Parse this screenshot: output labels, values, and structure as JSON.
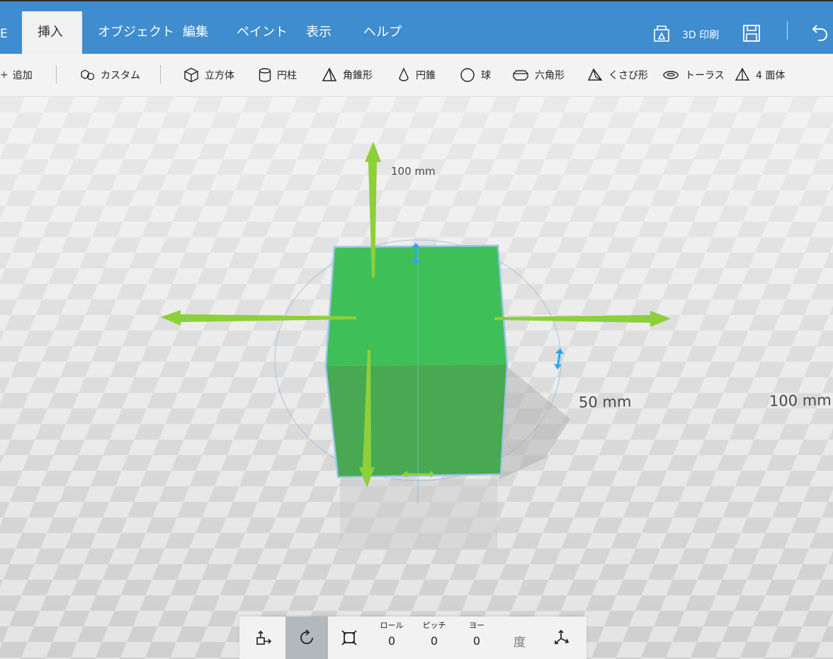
{
  "menubar": {
    "edge_label": "E",
    "tabs": [
      {
        "label": "挿入",
        "active": true
      },
      {
        "label": "オブジェクト",
        "active": false
      },
      {
        "label": "編集",
        "active": false
      },
      {
        "label": "ペイント",
        "active": false
      },
      {
        "label": "表示",
        "active": false
      },
      {
        "label": "ヘルプ",
        "active": false
      }
    ],
    "print_label": "3D 印刷"
  },
  "ribbon": {
    "add_label": "追加",
    "custom_label": "カスタム",
    "shapes": [
      {
        "label": "立方体",
        "icon": "cube-icon"
      },
      {
        "label": "円柱",
        "icon": "cylinder-icon"
      },
      {
        "label": "角錐形",
        "icon": "pyramid-icon"
      },
      {
        "label": "円錐",
        "icon": "cone-icon"
      },
      {
        "label": "球",
        "icon": "sphere-icon"
      },
      {
        "label": "六角形",
        "icon": "hexagon-icon"
      },
      {
        "label": "くさび形",
        "icon": "wedge-icon"
      },
      {
        "label": "トーラス",
        "icon": "torus-icon"
      },
      {
        "label": "4 面体",
        "icon": "tetrahedron-icon"
      }
    ]
  },
  "viewport": {
    "dimension_labels": [
      "100 mm",
      "50 mm",
      "100 mm"
    ],
    "object_color": "#3fbf58",
    "arrow_color": "#8dd03a",
    "handle_color": "#2aa8f0"
  },
  "transform_bar": {
    "roll_label": "ロール",
    "roll_value": "0",
    "pitch_label": "ピッチ",
    "pitch_value": "0",
    "yaw_label": "ヨー",
    "yaw_value": "0",
    "unit_label": "度"
  },
  "colors": {
    "menubar": "#3f8ccf",
    "ribbon": "#f3f3f3",
    "active_tool": "#b3b8bd"
  }
}
